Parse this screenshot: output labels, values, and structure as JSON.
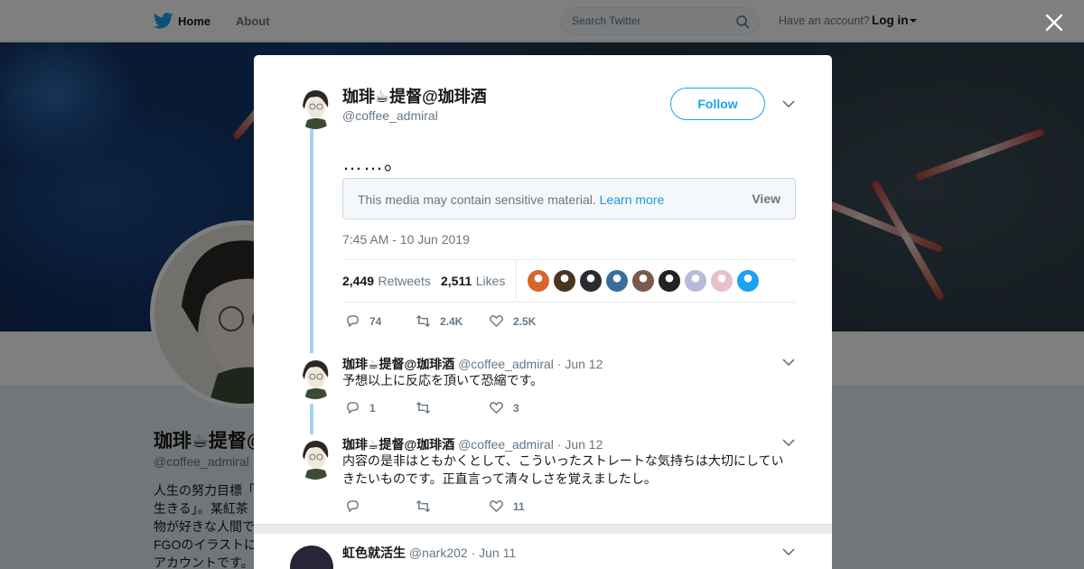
{
  "nav": {
    "home": "Home",
    "about": "About",
    "search_placeholder": "Search Twitter",
    "have_account": "Have an account?",
    "login": "Log in"
  },
  "profile": {
    "name": "珈琲☕提督@珈琲酒",
    "handle": "@coffee_admiral",
    "bio_lines": [
      "人生の努力目標「",
      "生きる」。某紅茶",
      "物が好きな人間で",
      "FGOのイラストに",
      "アカウントです。"
    ]
  },
  "tweet": {
    "author_name": "珈琲☕提督@珈琲酒",
    "author_handle": "@coffee_admiral",
    "follow_label": "Follow",
    "text": "……。",
    "sensitive_text": "This media may contain sensitive material.",
    "sensitive_link": "Learn more",
    "sensitive_view": "View",
    "timestamp": "7:45 AM - 10 Jun 2019",
    "retweets_count": "2,449",
    "retweets_label": "Retweets",
    "likes_count": "2,511",
    "likes_label": "Likes",
    "actions": {
      "replies": "74",
      "retweets": "2.4K",
      "likes": "2.5K"
    },
    "likers_colors": [
      "#d9642b",
      "#4a3520",
      "#2a2a30",
      "#3b6d9c",
      "#7a5a48",
      "#222222",
      "#b9b9d9",
      "#e8c0cc",
      "#1da1f2"
    ]
  },
  "replies": [
    {
      "name": "珈琲☕提督@珈琲酒",
      "handle": "@coffee_admiral",
      "date": "· Jun 12",
      "text": "予想以上に反応を頂いて恐縮です。",
      "replies": "1",
      "retweets": "",
      "likes": "3"
    },
    {
      "name": "珈琲☕提督@珈琲酒",
      "handle": "@coffee_admiral",
      "date": "· Jun 12",
      "text": "内容の是非はともかくとして、こういったストレートな気持ちは大切にしていきたいものです。正直言って清々しさを覚えましたし。",
      "replies": "",
      "retweets": "",
      "likes": "11"
    }
  ],
  "next_tweet": {
    "name": "虹色就活生",
    "handle": "@nark202",
    "date": "· Jun 11"
  },
  "colors": {
    "accent": "#1da1f2",
    "thread_line": "#a3d4f2",
    "muted": "#657786"
  }
}
